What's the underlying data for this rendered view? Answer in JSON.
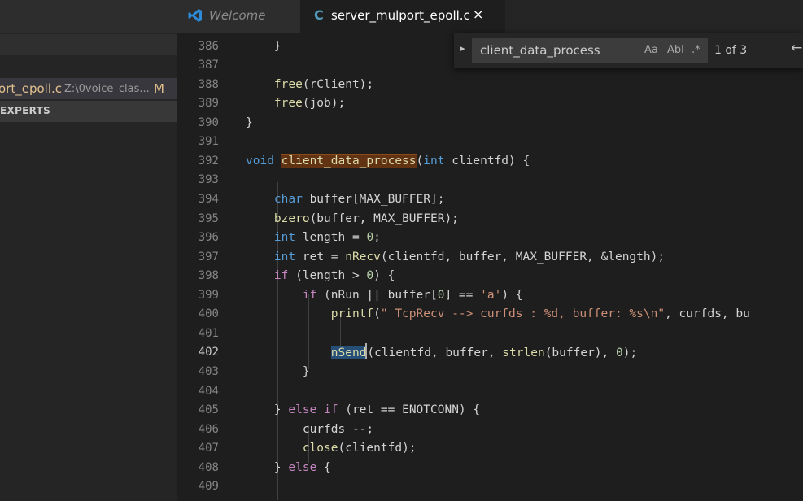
{
  "sidebar": {
    "file": {
      "name": "ort_epoll.c",
      "path": "Z:\\0voice_clas...",
      "badge": "M"
    },
    "section_label": "EXPERTS"
  },
  "tabs": [
    {
      "label": "Welcome",
      "icon": "vscode-icon"
    },
    {
      "label": "server_mulport_epoll.c",
      "icon": "c-file-icon",
      "type_glyph": "C",
      "close": "×"
    }
  ],
  "find": {
    "toggle": "▸",
    "query": "client_data_process",
    "match_case": "Aa",
    "whole_word": "Abl",
    "regex": ".*",
    "count": "1 of 3",
    "prev": "←"
  },
  "editor": {
    "active_line": 402,
    "lines": [
      {
        "n": "386",
        "code": "    }"
      },
      {
        "n": "387",
        "code": ""
      },
      {
        "n": "388",
        "code": "    free(rClient);"
      },
      {
        "n": "389",
        "code": "    free(job);"
      },
      {
        "n": "390",
        "code": "}"
      },
      {
        "n": "391",
        "code": ""
      },
      {
        "n": "392",
        "code": "void client_data_process(int clientfd) {"
      },
      {
        "n": "393",
        "code": ""
      },
      {
        "n": "394",
        "code": "    char buffer[MAX_BUFFER];"
      },
      {
        "n": "395",
        "code": "    bzero(buffer, MAX_BUFFER);"
      },
      {
        "n": "396",
        "code": "    int length = 0;"
      },
      {
        "n": "397",
        "code": "    int ret = nRecv(clientfd, buffer, MAX_BUFFER, &length);"
      },
      {
        "n": "398",
        "code": "    if (length > 0) {"
      },
      {
        "n": "399",
        "code": "        if (nRun || buffer[0] == 'a') {"
      },
      {
        "n": "400",
        "code": "            printf(\" TcpRecv --> curfds : %d, buffer: %s\\n\", curfds, bu"
      },
      {
        "n": "401",
        "code": ""
      },
      {
        "n": "402",
        "code": "            nSend(clientfd, buffer, strlen(buffer), 0);"
      },
      {
        "n": "403",
        "code": "        }"
      },
      {
        "n": "404",
        "code": ""
      },
      {
        "n": "405",
        "code": "    } else if (ret == ENOTCONN) {"
      },
      {
        "n": "406",
        "code": "        curfds --;"
      },
      {
        "n": "407",
        "code": "        close(clientfd);"
      },
      {
        "n": "408",
        "code": "    } else {"
      },
      {
        "n": "409",
        "code": ""
      }
    ]
  },
  "colors": {
    "keyword": "#569cd6",
    "control": "#c586c0",
    "function": "#dcdcaa",
    "string": "#ce9178",
    "number": "#b5cea8",
    "find_match_bg": "#613214",
    "selection_bg": "#264f78"
  }
}
